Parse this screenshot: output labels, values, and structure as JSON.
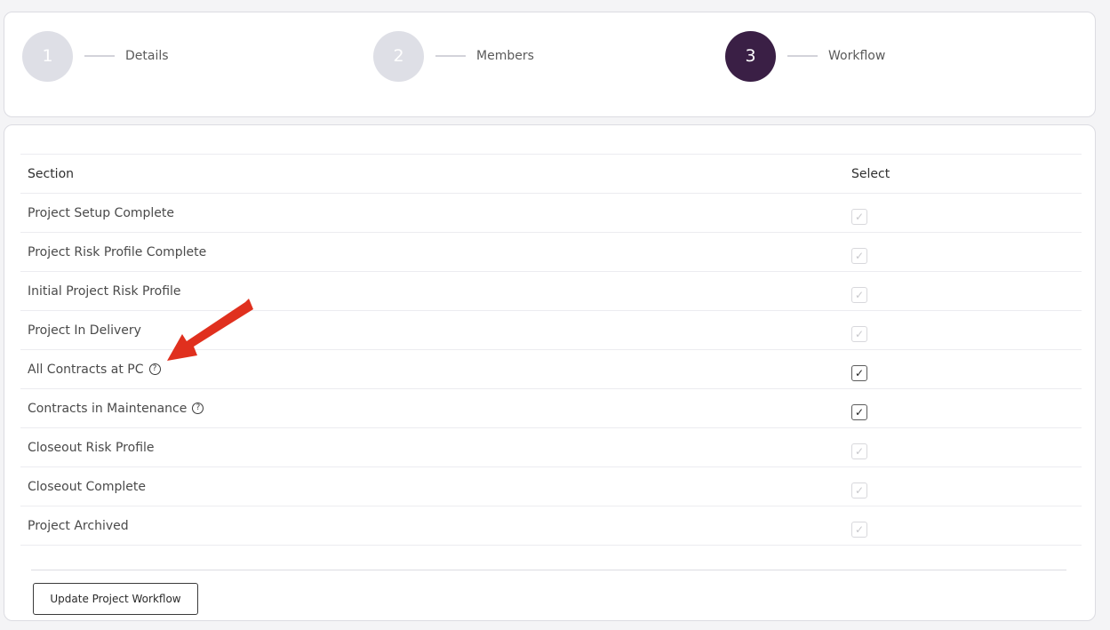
{
  "steps": [
    {
      "number": "1",
      "label": "Details",
      "active": false
    },
    {
      "number": "2",
      "label": "Members",
      "active": false
    },
    {
      "number": "3",
      "label": "Workflow",
      "active": true
    }
  ],
  "table": {
    "headers": {
      "section": "Section",
      "select": "Select"
    },
    "rows": [
      {
        "label": "Project Setup Complete",
        "checked": true,
        "enabled": false,
        "help": false
      },
      {
        "label": "Project Risk Profile Complete",
        "checked": true,
        "enabled": false,
        "help": false
      },
      {
        "label": "Initial Project Risk Profile",
        "checked": true,
        "enabled": false,
        "help": false
      },
      {
        "label": "Project In Delivery",
        "checked": true,
        "enabled": false,
        "help": false
      },
      {
        "label": "All Contracts at PC",
        "checked": true,
        "enabled": true,
        "help": true
      },
      {
        "label": "Contracts in Maintenance",
        "checked": true,
        "enabled": true,
        "help": true
      },
      {
        "label": "Closeout Risk Profile",
        "checked": true,
        "enabled": false,
        "help": false
      },
      {
        "label": "Closeout Complete",
        "checked": true,
        "enabled": false,
        "help": false
      },
      {
        "label": "Project Archived",
        "checked": true,
        "enabled": false,
        "help": false
      }
    ]
  },
  "footer": {
    "update_label": "Update Project Workflow"
  },
  "icons": {
    "help": "question-circle-icon",
    "check": "check-icon",
    "annotation": "red-arrow"
  },
  "colors": {
    "active_step": "#3a1f45",
    "inactive_step": "#dedfe6",
    "arrow": "#e0301e"
  }
}
